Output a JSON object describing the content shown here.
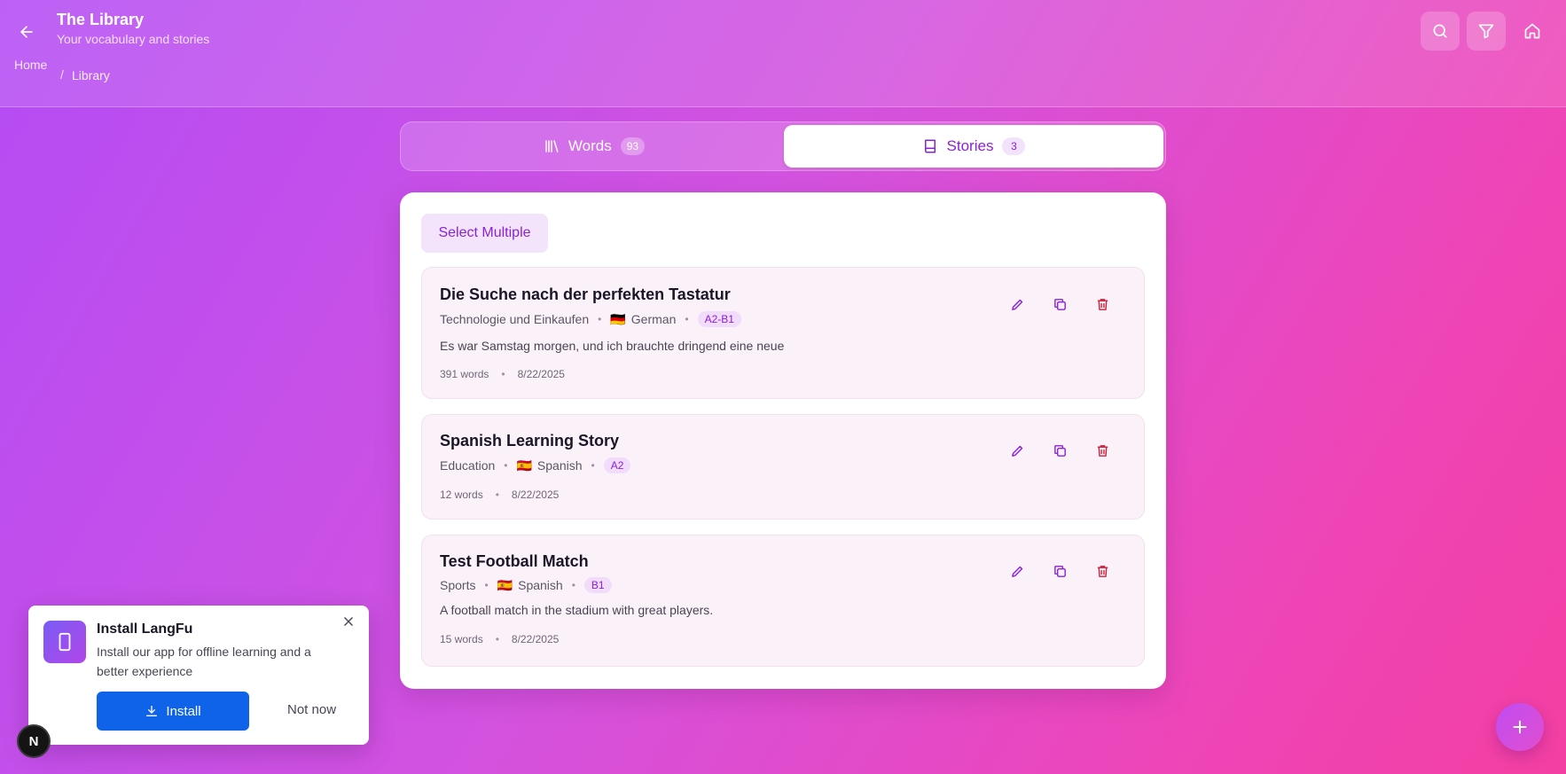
{
  "header": {
    "title": "The Library",
    "subtitle": "Your vocabulary and stories",
    "breadcrumb": {
      "home": "Home",
      "separator": "/",
      "current": "Library"
    }
  },
  "tabs": {
    "words": {
      "label": "Words",
      "count": "93"
    },
    "stories": {
      "label": "Stories",
      "count": "3"
    }
  },
  "toolbar": {
    "select_multiple": "Select Multiple"
  },
  "stories": [
    {
      "title": "Die Suche nach der perfekten Tastatur",
      "topic": "Technologie und Einkaufen",
      "flag": "🇩🇪",
      "language": "German",
      "level": "A2-B1",
      "description": "Es war Samstag morgen, und ich brauchte dringend eine neue",
      "words": "391 words",
      "date": "8/22/2025"
    },
    {
      "title": "Spanish Learning Story",
      "topic": "Education",
      "flag": "🇪🇸",
      "language": "Spanish",
      "level": "A2",
      "description": "",
      "words": "12 words",
      "date": "8/22/2025"
    },
    {
      "title": "Test Football Match",
      "topic": "Sports",
      "flag": "🇪🇸",
      "language": "Spanish",
      "level": "B1",
      "description": "A football match in the stadium with great players.",
      "words": "15 words",
      "date": "8/22/2025"
    }
  ],
  "meta_separator": "•",
  "install_prompt": {
    "title": "Install LangFu",
    "body": "Install our app for offline learning and a better experience",
    "install_label": "Install",
    "dismiss_label": "Not now"
  },
  "dev_badge": "N",
  "colors": {
    "accent": "#8a22d6",
    "delete": "#d0213a",
    "install_button": "#0f63e8"
  },
  "icons": [
    "arrow-left-icon",
    "search-icon",
    "filter-icon",
    "home-icon",
    "library-icon",
    "book-icon",
    "pencil-icon",
    "copy-icon",
    "trash-icon",
    "smartphone-icon",
    "close-icon",
    "download-icon",
    "plus-icon"
  ]
}
